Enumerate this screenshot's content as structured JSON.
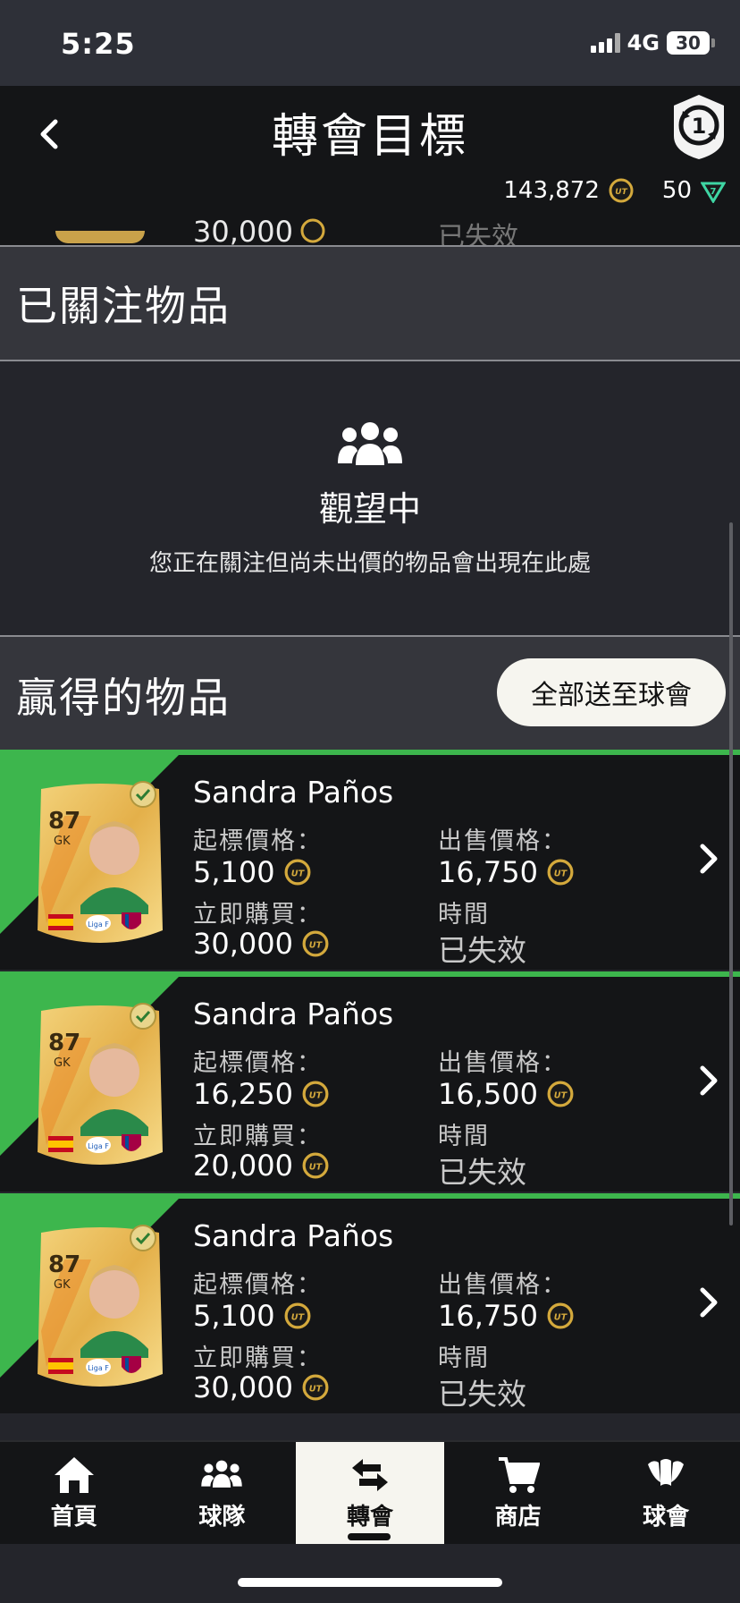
{
  "status": {
    "time": "5:25",
    "network": "4G",
    "battery": "30"
  },
  "header": {
    "title": "轉會目標",
    "coins": "143,872",
    "points": "50"
  },
  "previous_row": {
    "buy_now": "30,000",
    "time_faded": "已失效"
  },
  "watched": {
    "title": "已關注物品",
    "empty_title": "觀望中",
    "empty_text": "您正在關注但尚未出價的物品會出現在此處"
  },
  "won": {
    "title": "贏得的物品",
    "send_all_label": "全部送至球會"
  },
  "labels": {
    "start_price": "起標價格：",
    "sold_price": "出售價格：",
    "buy_now": "立即購買：",
    "time": "時間"
  },
  "items": [
    {
      "name": "Sandra Paños",
      "rating": "87",
      "position": "GK",
      "league": "Liga F",
      "start_price": "5,100",
      "sold_price": "16,750",
      "buy_now": "30,000",
      "status": "已失效"
    },
    {
      "name": "Sandra Paños",
      "rating": "87",
      "position": "GK",
      "league": "Liga F",
      "start_price": "16,250",
      "sold_price": "16,500",
      "buy_now": "20,000",
      "status": "已失效"
    },
    {
      "name": "Sandra Paños",
      "rating": "87",
      "position": "GK",
      "league": "Liga F",
      "start_price": "5,100",
      "sold_price": "16,750",
      "buy_now": "30,000",
      "status": "已失效"
    }
  ],
  "tabs": [
    {
      "label": "首頁",
      "icon": "home-icon",
      "active": false
    },
    {
      "label": "球隊",
      "icon": "squad-icon",
      "active": false
    },
    {
      "label": "轉會",
      "icon": "transfer-icon",
      "active": true
    },
    {
      "label": "商店",
      "icon": "cart-icon",
      "active": false
    },
    {
      "label": "球會",
      "icon": "club-icon",
      "active": false
    }
  ],
  "colors": {
    "accent_green": "#3db64d",
    "gold": "#d4a93c",
    "bg_dark": "#141517",
    "bg_mid": "#24252b"
  }
}
